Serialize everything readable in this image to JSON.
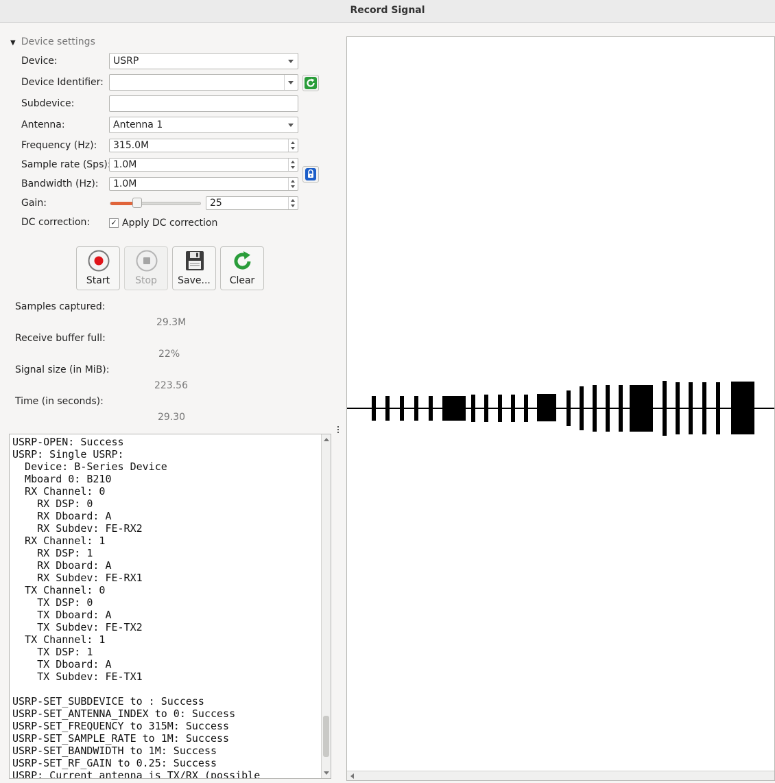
{
  "window": {
    "title": "Record Signal"
  },
  "device_settings": {
    "header": "Device settings",
    "device": {
      "label": "Device:",
      "value": "USRP"
    },
    "device_identifier": {
      "label": "Device Identifier:",
      "value": ""
    },
    "subdevice": {
      "label": "Subdevice:",
      "value": ""
    },
    "antenna": {
      "label": "Antenna:",
      "value": "Antenna 1"
    },
    "frequency": {
      "label": "Frequency (Hz):",
      "value": "315.0M"
    },
    "sample_rate": {
      "label": "Sample rate (Sps):",
      "value": "1.0M"
    },
    "bandwidth": {
      "label": "Bandwidth (Hz):",
      "value": "1.0M"
    },
    "gain": {
      "label": "Gain:",
      "value": "25",
      "slider_fraction": 0.25
    },
    "dc_correction": {
      "label": "DC correction:",
      "checkbox_label": "Apply DC correction",
      "checked": true
    }
  },
  "toolbar": {
    "start_label": "Start",
    "stop_label": "Stop",
    "save_label": "Save...",
    "clear_label": "Clear"
  },
  "stats": {
    "samples_captured": {
      "label": "Samples captured:",
      "value": "29.3M"
    },
    "receive_buffer": {
      "label": "Receive buffer full:",
      "value": "22%"
    },
    "signal_size": {
      "label": "Signal size (in MiB):",
      "value": "223.56"
    },
    "time": {
      "label": "Time (in seconds):",
      "value": "29.30"
    }
  },
  "log": {
    "text": "USRP-OPEN: Success\nUSRP: Single USRP:\n  Device: B-Series Device\n  Mboard 0: B210\n  RX Channel: 0\n    RX DSP: 0\n    RX Dboard: A\n    RX Subdev: FE-RX2\n  RX Channel: 1\n    RX DSP: 1\n    RX Dboard: A\n    RX Subdev: FE-RX1\n  TX Channel: 0\n    TX DSP: 0\n    TX Dboard: A\n    TX Subdev: FE-TX2\n  TX Channel: 1\n    TX DSP: 1\n    TX Dboard: A\n    TX Subdev: FE-TX1\n\nUSRP-SET_SUBDEVICE to : Success\nUSRP-SET_ANTENNA_INDEX to 0: Success\nUSRP-SET_FREQUENCY to 315M: Success\nUSRP-SET_SAMPLE_RATE to 1M: Success\nUSRP-SET_BANDWIDTH to 1M: Success\nUSRP-SET_RF_GAIN to 0.25: Success\nUSRP: Current antenna is TX/RX (possible"
  },
  "colors": {
    "accent_orange": "#e0643a",
    "record_red": "#e0141a",
    "refresh_green": "#2a9d3a",
    "lock_blue": "#1d5fc9"
  }
}
